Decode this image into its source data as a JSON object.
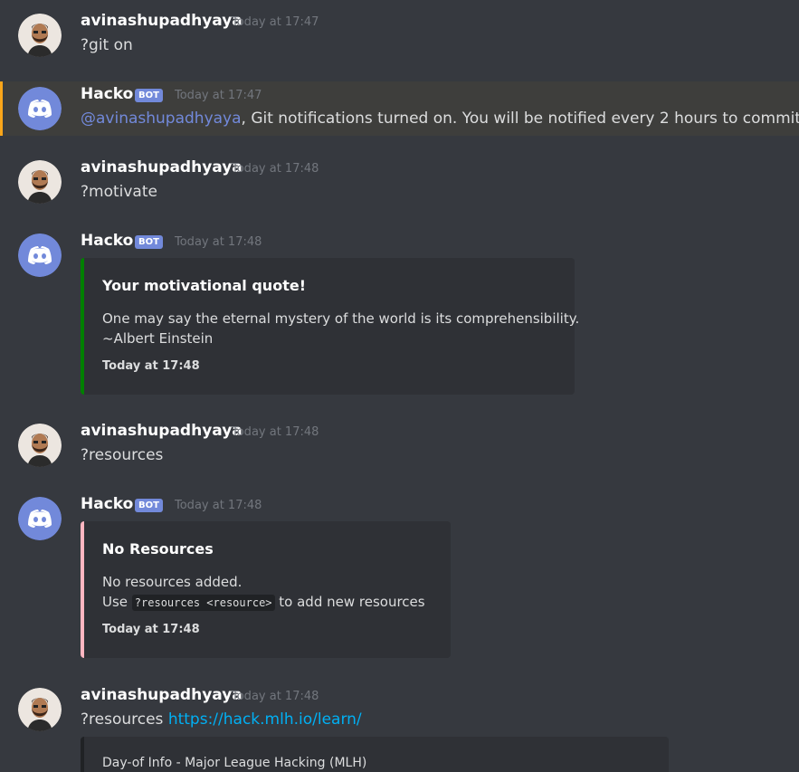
{
  "messages": [
    {
      "username": "avinashupadhyaya",
      "timestamp": "Today at 17:47",
      "text": "?git on"
    },
    {
      "username": "Hacko",
      "bot_tag": "BOT",
      "timestamp": "Today at 17:47",
      "mention": "@avinashupadhyaya",
      "text": ", Git notifications turned on. You will be notified every 2 hours to commit"
    },
    {
      "username": "avinashupadhyaya",
      "timestamp": "Today at 17:48",
      "text": "?motivate"
    },
    {
      "username": "Hacko",
      "bot_tag": "BOT",
      "timestamp": "Today at 17:48",
      "embed": {
        "title": "Your motivational quote!",
        "line1": "One may say the eternal mystery of the world is its comprehensibility.",
        "line2": "~Albert Einstein",
        "footer": "Today at 17:48",
        "accent": "#008000"
      }
    },
    {
      "username": "avinashupadhyaya",
      "timestamp": "Today at 17:48",
      "text": "?resources"
    },
    {
      "username": "Hacko",
      "bot_tag": "BOT",
      "timestamp": "Today at 17:48",
      "embed": {
        "title": "No Resources",
        "line1": "No resources added.",
        "line2_prefix": "Use ",
        "line2_code": "?resources <resource>",
        "line2_suffix": " to add new resources",
        "footer": "Today at 17:48",
        "accent": "#ffb6c1"
      }
    },
    {
      "username": "avinashupadhyaya",
      "timestamp": "Today at 17:48",
      "text": "?resources ",
      "link": "https://hack.mlh.io/learn/",
      "embed": {
        "line1": "Day-of Info - Major League Hacking (MLH)"
      }
    }
  ],
  "colors": {
    "background": "#36393f",
    "embed_bg": "#2f3136",
    "bot_tag": "#7289da",
    "mention": "#7289da",
    "link": "#00b0f4",
    "highlight_border": "#faa61a"
  }
}
